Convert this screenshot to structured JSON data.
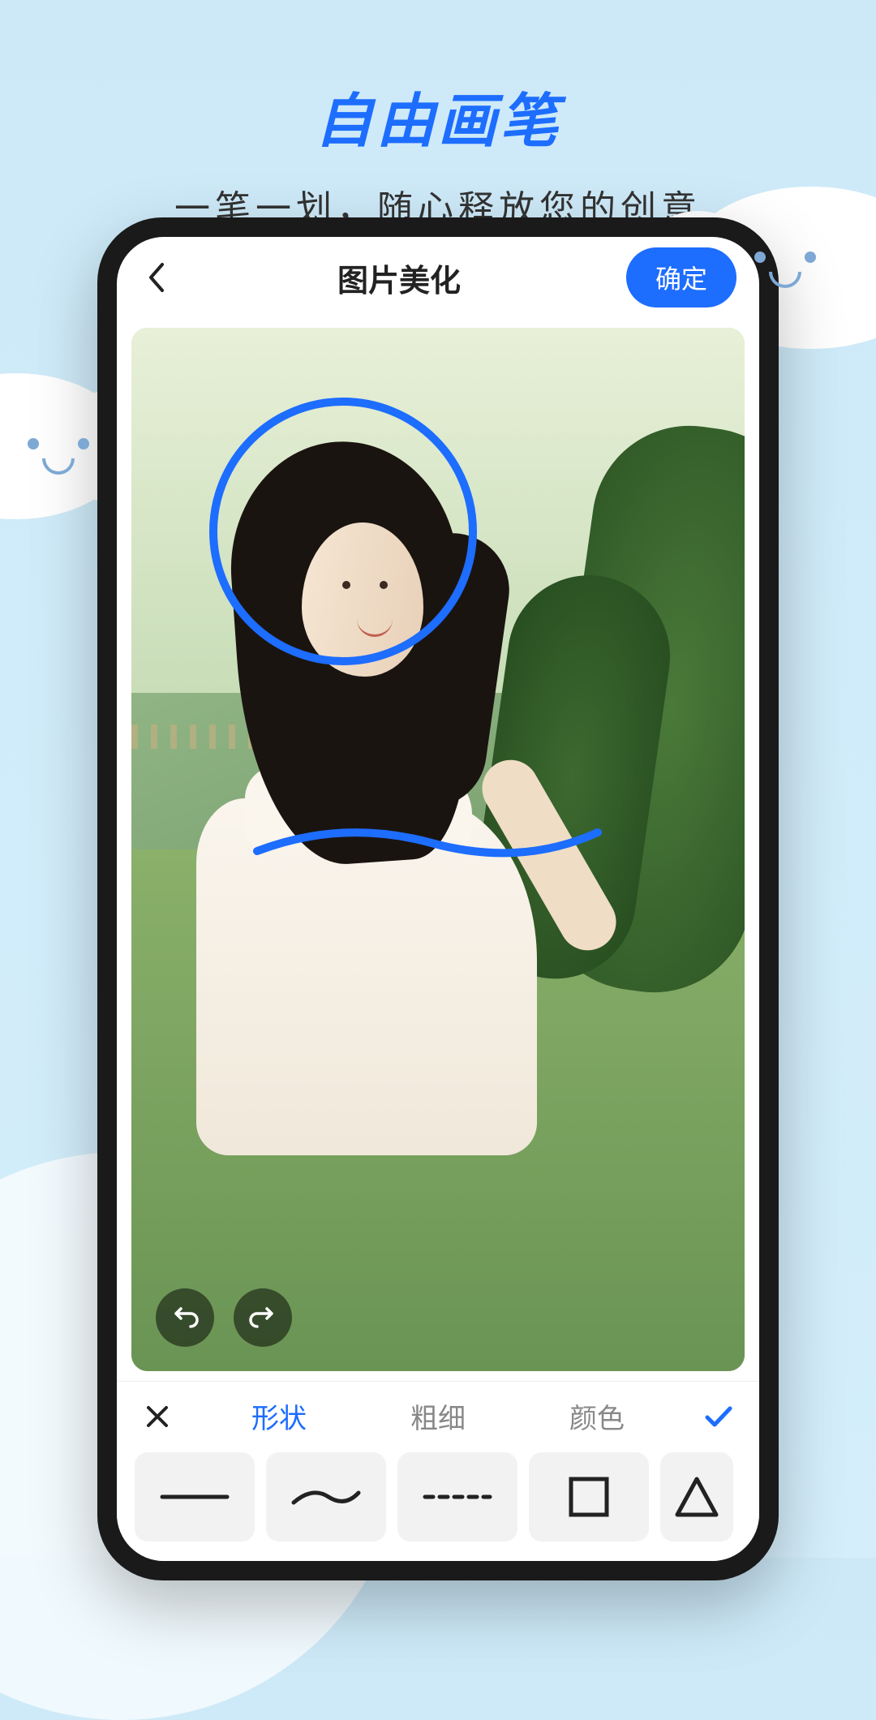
{
  "hero": {
    "title": "自由画笔",
    "subtitle": "一笔一划，随心释放您的创意"
  },
  "nav": {
    "title": "图片美化",
    "confirm": "确定"
  },
  "toolbar": {
    "tabs": [
      "形状",
      "粗细",
      "颜色"
    ],
    "active_tab": 0,
    "shapes": [
      "line",
      "wave",
      "dashed",
      "square",
      "triangle"
    ]
  },
  "colors": {
    "accent": "#1d6dff"
  }
}
